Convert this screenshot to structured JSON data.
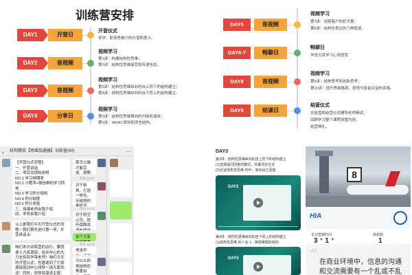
{
  "schedule": {
    "title": "训练营安排",
    "left_rows": [
      {
        "day": "DAY1",
        "label": "开营日"
      },
      {
        "day": "DAY2",
        "label": "音视频"
      },
      {
        "day": "DAY3",
        "label": "音视频"
      },
      {
        "day": "DAY4",
        "label": "分享日"
      }
    ],
    "left_timeline": [
      {
        "head": "开营仪式",
        "lines": [
          "导学：职场思维力的价值和意义。"
        ],
        "color": "#f4b63a"
      },
      {
        "head": "视频学习",
        "lines": [
          "第1讲：构建结构性思维；",
          "第2讲：结构性思维接受和传递信息。"
        ],
        "color": "#5fb36b"
      },
      {
        "head": "视频学习",
        "lines": [
          "第3讲：结构性思维纵向的自上而下的结构建立；",
          "第4讲：结构性思维纵向的自下而上的结构建立。"
        ],
        "color": "#e66a6a"
      },
      {
        "head": "视频学习",
        "lines": [
          "第5讲：结构性思维横向的归纳和演绎；",
          "第6讲：MEMC原则和序言结构。"
        ],
        "color": "#5c8fe0"
      }
    ],
    "right_rows": [
      {
        "day": "DAY5",
        "label": "音视频"
      },
      {
        "day": "DAY6-7",
        "label": "畅聊日"
      },
      {
        "day": "DAY8",
        "label": "音视频"
      },
      {
        "day": "DAY9",
        "label": "结课日"
      }
    ],
    "right_timeline": [
      {
        "head": "视频学习",
        "lines": [
          "第7讲：说服客户的好文案；",
          "第8讲：结构化表达的六种框架。"
        ],
        "color": "#f4b63a"
      },
      {
        "head": "畅聊日",
        "lines": [
          "学员分享学习心得感受"
        ],
        "color": "#5fb36b"
      },
      {
        "head": "视频学习",
        "lines": [
          "第9讲：结构思考和创新思考；",
          "第10讲：提升思维格局，获得与智者对话的资格。"
        ],
        "color": "#e66a6a"
      },
      {
        "head": "结营仪式",
        "lines": [
          "总复盘和结营仪式辅导老师精讲；",
          "回顾学习整个课程设置内容；",
          "结营典礼。"
        ],
        "color": "#5c8fe0"
      }
    ]
  },
  "chat": {
    "title": "机构精英【思维加速器】训练营(69)",
    "left_messages": [
      {
        "text": "【开营仪式流程】\n一、开营讲话\n二、项目及规则说明\nNO.1 学习排期表\nNO.2 小程序+微信群的学习阵地\nNO.3 学习积分规则\nNO.4 积分制度\nNO.5 积分奖励\n三、授课老师自我介绍\n四、学员自我介绍\n学习平台使用及第一次打卡"
      },
      {
        "text": "以上是我们今天开营仪式的流程～我们首先进行第一项，开营讲话🎉"
      },
      {
        "text": "咱们本次训练营的运行，要感谢人力资源部，培训中心的大力支持及学带老师！咱们今天的开营仪式，也邀请到了力资源部培训中心领导～请大家欢迎！同时，领导部演讲主题：非常感谢王老主发挥好各位精英！"
      }
    ],
    "right_messages": [
      {
        "text": "那怎么做才能完成、周期做动作呢呢呢"
      },
      {
        "text": "对于新首，打造一体化，无缝得的乘机流程，减少航班延误精费，提升机场的交通便利程度"
      },
      {
        "text": "对于航空公司，提升保障资源的使用效率，提高航班准点率与协同效率水平"
      },
      {
        "text": "这个分享就很重要了"
      },
      {
        "text": "考虑不全，还请老师指点🙏"
      },
      {
        "text": "可以从四类结构化角度出发：平安——建立安全体系，安全学核心；联一一联动：结构、路化一一统一整合；协调等——"
      }
    ],
    "timestamps": [
      "昨天 16:22",
      "昨天 16:22",
      "昨天 16:23"
    ]
  },
  "doc": {
    "title": "DAY3",
    "lines_top": [
      "第3讲：结构性思维纵向的自上而下的结构建立",
      "(1)选择提问回答的模式，关键词定位法",
      "(2)论证结构性思维 的叶，来找出它回答"
    ],
    "video1_day": "DAY2",
    "lines_mid": [
      "第4讲：结构性思维纵向的自下而上的结构建立",
      "(1)结构性思维 的人会 1、演绎推理的结构"
    ],
    "video2_day": "DAY3"
  },
  "airport": {
    "gate_number": "8",
    "stat1_label": "本次营期时间",
    "stat1_value": "3 ⁺ 1 ⁺",
    "stat2_label": "做题数",
    "stat2_value": "1",
    "quote_lines": [
      "在商业环境中，信息的沟通",
      "和交流需要有一个乱或不乱"
    ]
  }
}
